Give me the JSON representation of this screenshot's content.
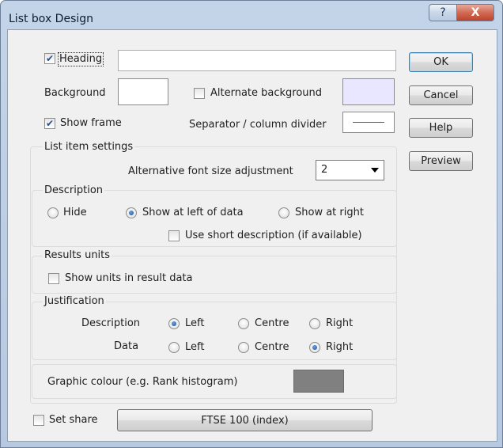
{
  "window": {
    "title": "List box Design"
  },
  "titlebar": {
    "help_glyph": "?",
    "close_glyph": "X"
  },
  "top": {
    "heading_label": "Heading",
    "heading_checked": true,
    "heading_value": "",
    "background_label": "Background",
    "background_color": "#ffffff",
    "alternate_label": "Alternate background",
    "alternate_checked": false,
    "alternate_color": "#e9e6ff",
    "show_frame_label": "Show frame",
    "show_frame_checked": true,
    "separator_label": "Separator / column divider",
    "separator_color": "#ffffff"
  },
  "buttons": {
    "ok": "OK",
    "cancel": "Cancel",
    "help": "Help",
    "preview": "Preview"
  },
  "list_item_settings": {
    "title": "List item settings",
    "font_adj_label": "Alternative font size adjustment",
    "font_adj_value": "2"
  },
  "description": {
    "title": "Description",
    "options": [
      "Hide",
      "Show at left of data",
      "Show at right"
    ],
    "selected": 1,
    "short_desc_label": "Use short description (if available)",
    "short_desc_checked": false
  },
  "results_units": {
    "title": "Results units",
    "show_units_label": "Show units in result data",
    "show_units_checked": false
  },
  "justification": {
    "title": "Justification",
    "rows": [
      {
        "label": "Description",
        "options": [
          "Left",
          "Centre",
          "Right"
        ],
        "selected": 0
      },
      {
        "label": "Data",
        "options": [
          "Left",
          "Centre",
          "Right"
        ],
        "selected": 2
      }
    ]
  },
  "graphic": {
    "label": "Graphic colour (e.g. Rank histogram)",
    "color": "#808080"
  },
  "footer": {
    "set_share_label": "Set share",
    "set_share_checked": false,
    "share_button": "FTSE 100 (index)"
  }
}
